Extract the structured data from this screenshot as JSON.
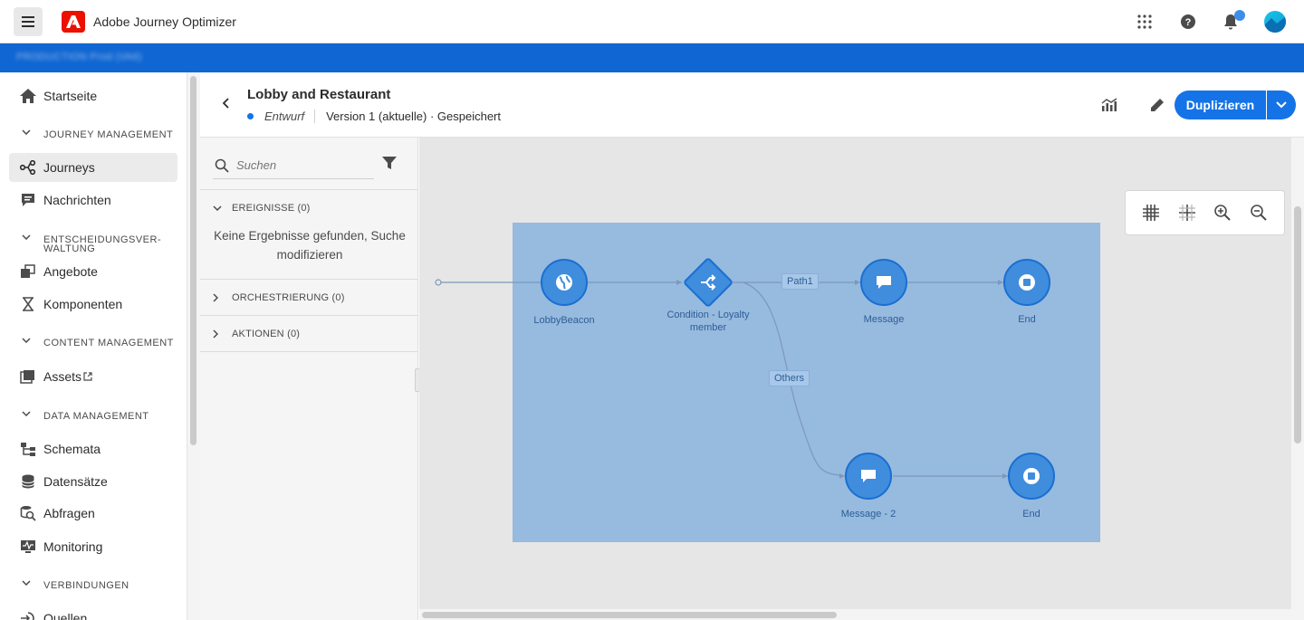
{
  "app": {
    "title": "Adobe Journey Optimizer",
    "org_text": "PRODUCTION  Prod (VA6)"
  },
  "nav": {
    "home": "Startseite",
    "sections": {
      "journey_management": "JOURNEY MANAGEMENT",
      "decisioning": "ENTSCHEIDUNGSVER-WALTUNG",
      "content_management": "CONTENT MANAGEMENT",
      "data_management": "DATA MANAGEMENT",
      "connections": "VERBINDUNGEN"
    },
    "items": {
      "journeys": "Journeys",
      "messages": "Nachrichten",
      "offers": "Angebote",
      "components": "Komponenten",
      "assets": "Assets",
      "schemas": "Schemata",
      "datasets": "Datensätze",
      "queries": "Abfragen",
      "monitoring": "Monitoring",
      "sources": "Quellen"
    }
  },
  "journey": {
    "title": "Lobby and Restaurant",
    "status": "Entwurf",
    "version": "Version 1 (aktuelle) · Gespeichert",
    "duplicate_label": "Duplizieren"
  },
  "palette": {
    "search_placeholder": "Suchen",
    "events_label": "EREIGNISSE (0)",
    "no_results": "Keine Ergebnisse gefunden, Suche modifizieren",
    "orchestration_label": "ORCHESTRIERUNG (0)",
    "actions_label": "AKTIONEN (0)"
  },
  "canvas": {
    "nodes": {
      "lobby": "LobbyBeacon",
      "condition": "Condition - Loyalty member",
      "message": "Message",
      "end1": "End",
      "message2": "Message - 2",
      "end2": "End"
    },
    "edges": {
      "path1": "Path1",
      "others": "Others"
    }
  },
  "colors": {
    "accent": "#1473e6",
    "orgbar": "#1066d2",
    "logo": "#eb1000",
    "selection": "#97badf",
    "node": "#3f8ddc"
  }
}
